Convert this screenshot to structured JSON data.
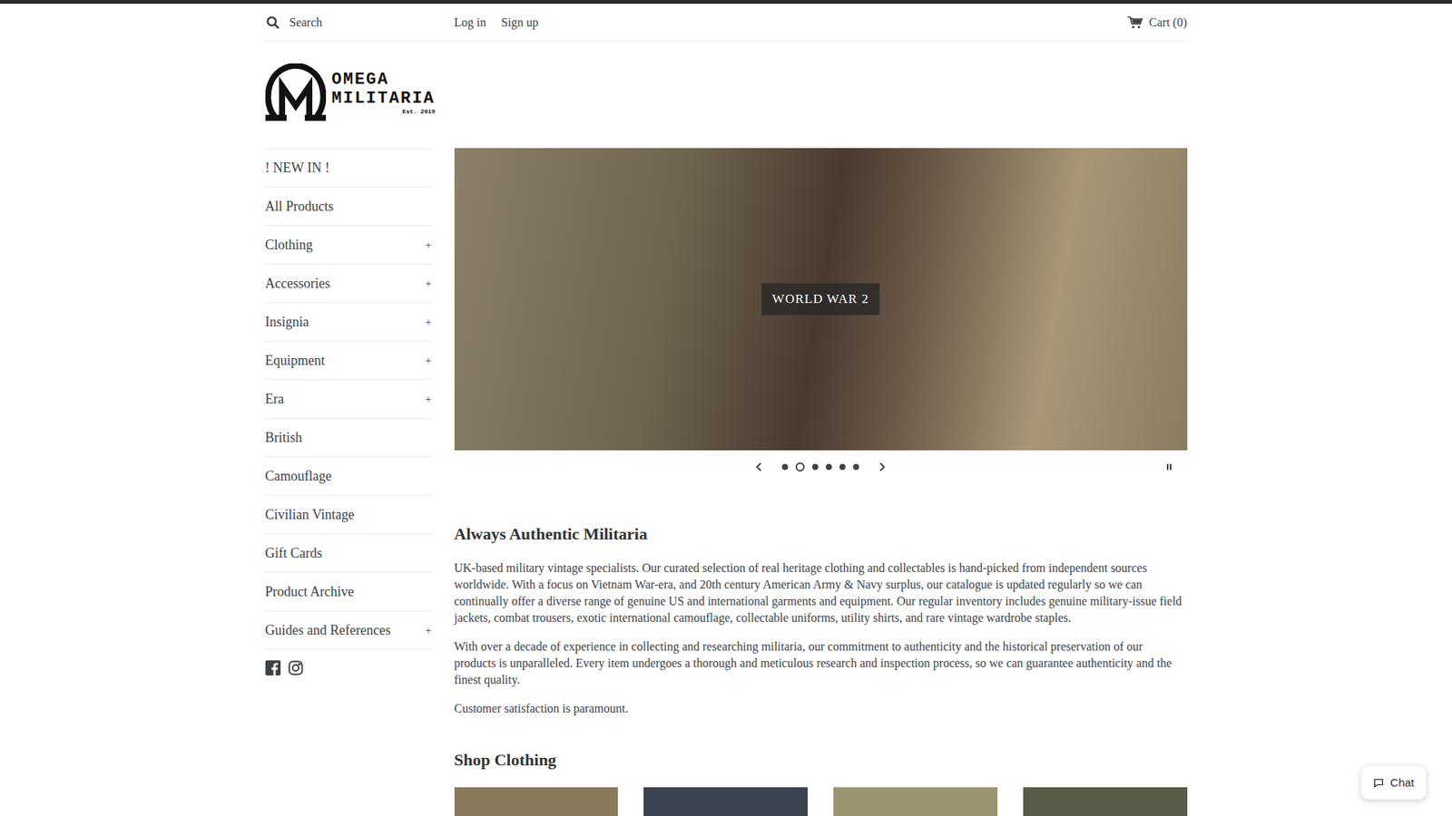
{
  "header": {
    "search": {
      "placeholder": "Search"
    },
    "links": [
      "Log in",
      "Sign up"
    ],
    "cart": "Cart (0)"
  },
  "logo": {
    "line1": "OMEGA",
    "line2": "MILITARIA",
    "est": "Est. 2019"
  },
  "sidebar": {
    "expand_icon": "+",
    "items": [
      {
        "label": "! NEW IN !",
        "expandable": false
      },
      {
        "label": "All Products",
        "expandable": false
      },
      {
        "label": "Clothing",
        "expandable": true
      },
      {
        "label": "Accessories",
        "expandable": true
      },
      {
        "label": "Insignia",
        "expandable": true
      },
      {
        "label": "Equipment",
        "expandable": true
      },
      {
        "label": "Era",
        "expandable": true
      },
      {
        "label": "British",
        "expandable": false
      },
      {
        "label": "Camouflage",
        "expandable": false
      },
      {
        "label": "Civilian Vintage",
        "expandable": false
      },
      {
        "label": "Gift Cards",
        "expandable": false
      },
      {
        "label": "Product Archive",
        "expandable": false
      },
      {
        "label": "Guides and References",
        "expandable": true
      }
    ]
  },
  "hero": {
    "caption": "WORLD WAR 2",
    "slides": [
      {
        "selected": false
      },
      {
        "selected": true
      },
      {
        "selected": false
      },
      {
        "selected": false
      },
      {
        "selected": false
      },
      {
        "selected": false
      }
    ]
  },
  "intro": {
    "heading": "Always Authentic Militaria",
    "paragraphs": [
      "UK-based military vintage specialists. Our curated selection of real heritage clothing and collectables is hand-picked from independent sources worldwide. With a focus on Vietnam War-era, and 20th century American Army & Navy surplus, our catalogue is updated regularly so we can continually offer a diverse range of genuine US and international garments and equipment. Our regular inventory includes genuine military-issue field jackets, combat trousers, exotic international camouflage, collectable uniforms, utility shirts, and rare vintage wardrobe staples.",
      "With over a decade of experience in collecting and researching militaria, our commitment to authenticity and the historical preservation of our products is unparalleled. Every item undergoes a thorough and meticulous research and inspection process, so we can guarantee authenticity and the finest quality.",
      "Customer satisfaction is paramount."
    ]
  },
  "shop": {
    "heading": "Shop Clothing",
    "tiles": [
      {
        "color": "#8a7a5c"
      },
      {
        "color": "#3b4350"
      },
      {
        "color": "#9a9470"
      },
      {
        "color": "#5a5a48"
      }
    ]
  },
  "chat": {
    "label": "Chat"
  }
}
